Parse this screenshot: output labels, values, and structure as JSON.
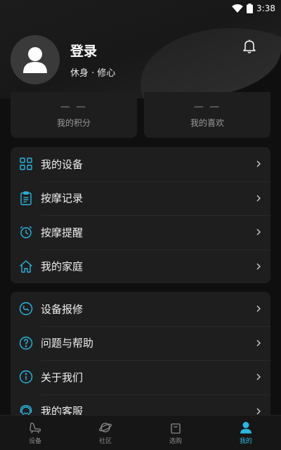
{
  "status_bar": {
    "time": "3:38",
    "wifi_icon": "wifi-icon",
    "battery_icon": "battery-icon"
  },
  "profile": {
    "avatar_icon": "user-avatar-icon",
    "title": "登录",
    "subtitle": "休身 · 修心",
    "bell_icon": "bell-icon"
  },
  "stats": [
    {
      "value": "— —",
      "label": "我的积分"
    },
    {
      "value": "— —",
      "label": "我的喜欢"
    }
  ],
  "menu_group_1": [
    {
      "label": "我的设备",
      "icon": "grid-icon"
    },
    {
      "label": "按摩记录",
      "icon": "clipboard-icon"
    },
    {
      "label": "按摩提醒",
      "icon": "alarm-clock-icon"
    },
    {
      "label": "我的家庭",
      "icon": "home-icon"
    }
  ],
  "menu_group_2": [
    {
      "label": "设备报修",
      "icon": "wrench-icon"
    },
    {
      "label": "问题与帮助",
      "icon": "help-icon"
    },
    {
      "label": "关于我们",
      "icon": "info-icon"
    },
    {
      "label": "我的客服",
      "icon": "headset-icon"
    }
  ],
  "bottom_nav": [
    {
      "label": "设备",
      "icon": "massage-chair-icon",
      "active": false
    },
    {
      "label": "社区",
      "icon": "planet-icon",
      "active": false
    },
    {
      "label": "选购",
      "icon": "shopping-bag-icon",
      "active": false
    },
    {
      "label": "我的",
      "icon": "profile-icon",
      "active": true
    }
  ],
  "colors": {
    "accent": "#2bb6e0",
    "background": "#0f0f0f",
    "card": "#1e1e1e"
  }
}
